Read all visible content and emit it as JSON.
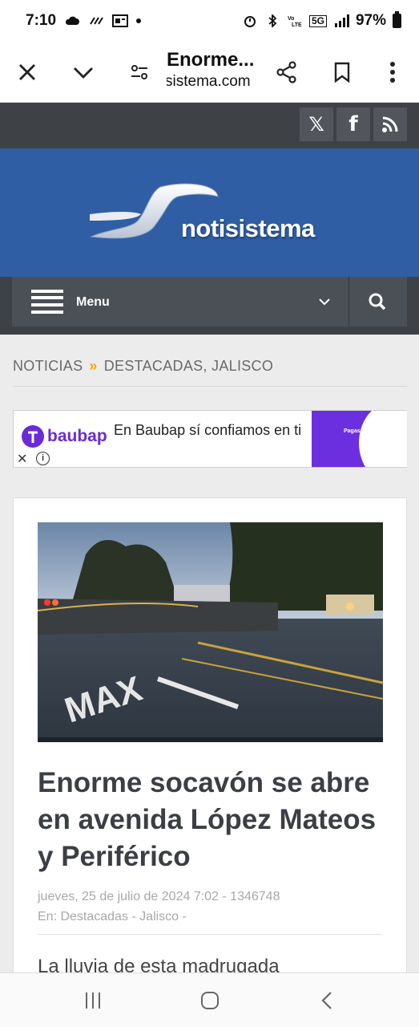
{
  "status_bar": {
    "time": "7:10",
    "battery": "97%",
    "network": "5G"
  },
  "browser": {
    "title": "Enorme socavón se abre en avenida López Mateos y Periférico",
    "title_short": "Enorme...",
    "domain": "sistema.com"
  },
  "social": {
    "items": [
      {
        "name": "x",
        "glyph": "𝕏"
      },
      {
        "name": "facebook",
        "glyph": "f"
      },
      {
        "name": "rss",
        "glyph": ""
      }
    ]
  },
  "header": {
    "logo_text": "notisistema"
  },
  "nav": {
    "menu_label": "Menu"
  },
  "breadcrumb": {
    "section": "NOTICIAS",
    "separator": "»",
    "categories": "DESTACADAS, JALISCO"
  },
  "ad": {
    "brand": "baubap",
    "text": "En Baubap sí confiamos en ti",
    "image_caption": "Pagas a tiempo"
  },
  "article": {
    "headline": "Enorme socavón se abre en avenida López Mateos y Periférico",
    "date_line": "jueves, 25 de julio de 2024 7:02 - 1346748",
    "categories_line": "En: Destacadas - Jalisco -",
    "excerpt": "La lluvia de esta madrugada",
    "road_marking": "MAX"
  },
  "colors": {
    "banner_blue": "#2f5ea5",
    "dark_bar": "#3e4247",
    "accent_arrow": "#f2a900",
    "ad_purple": "#6b2fe0"
  }
}
